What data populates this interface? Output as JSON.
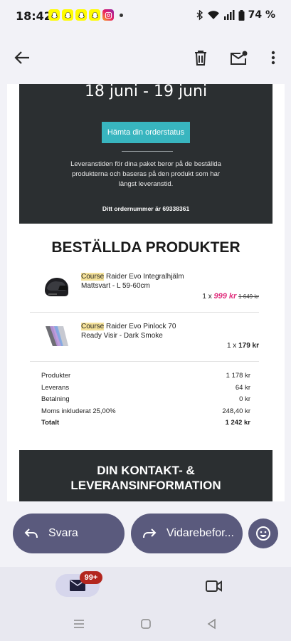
{
  "status_bar": {
    "time": "18:42",
    "battery": "74 %",
    "notification_icons": [
      "snapchat-icon",
      "snapchat-icon",
      "snapchat-icon",
      "snapchat-icon",
      "instagram-icon"
    ]
  },
  "toolbar": {
    "icons": [
      "back-arrow-icon",
      "delete-icon",
      "mark-unread-icon",
      "more-options-icon"
    ]
  },
  "email": {
    "delivery_range": "18 juni - 19 juni",
    "order_status_button": "Hämta din orderstatus",
    "lead_text": "Leveranstiden för dina paket beror på de beställda produkterna och baseras på den produkt som har längst leveranstid.",
    "order_number": "Ditt ordernummer är 69338361",
    "products_title": "BESTÄLLDA PRODUKTER",
    "products": [
      {
        "brand": "Course",
        "name": " Raider Evo Integralhjälm",
        "variant": "Mattsvart - L 59-60cm",
        "qty": "1 x",
        "price": "999 kr",
        "old_price": "1 649 kr",
        "image_icon": "helmet-icon"
      },
      {
        "brand": "Course",
        "name": " Raider Evo Pinlock 70",
        "variant": "Ready Visir - Dark Smoke",
        "qty": "1 x",
        "price": "179 kr",
        "image_icon": "visor-icon"
      }
    ],
    "summary": [
      {
        "label": "Produkter",
        "value": "1 178 kr"
      },
      {
        "label": "Leverans",
        "value": "64 kr"
      },
      {
        "label": "Betalning",
        "value": "0 kr"
      },
      {
        "label": "Moms inkluderat 25,00%",
        "value": "248,40 kr"
      },
      {
        "label": "Totalt",
        "value": "1 242 kr"
      }
    ],
    "contact_title_line1": "DIN KONTAKT- &",
    "contact_title_line2": "LEVERANSINFORMATION"
  },
  "actions": {
    "reply_label": "Svara",
    "forward_label": "Vidarebefor..."
  },
  "bottom_nav": {
    "mail_badge": "99+"
  },
  "colors": {
    "dark_panel": "#2b2f31",
    "accent_button": "#38b5bf",
    "sale_price": "#e0307e",
    "highlight": "#f5e29a",
    "action_pill": "#5a5a7d",
    "badge": "#b3261e"
  }
}
